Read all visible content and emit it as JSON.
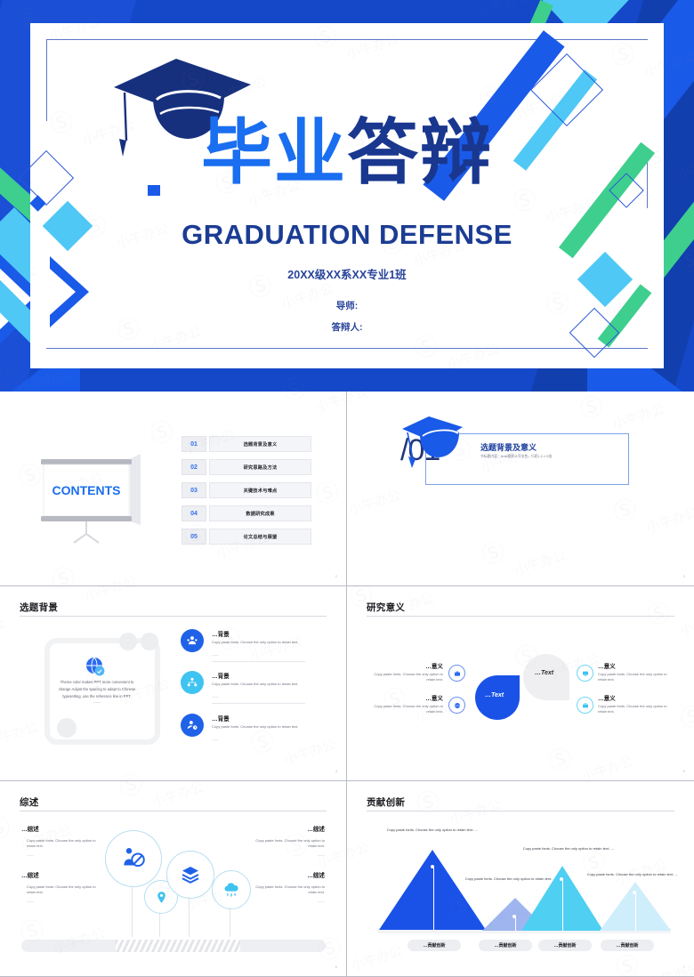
{
  "cover": {
    "title_light": "毕业",
    "title_dark": "答辩",
    "english_title": "GRADUATION DEFENSE",
    "class_line": "20XX级XX系XX专业1班",
    "advisor": "导师:",
    "presenter": "答辩人:",
    "icon_cap": "graduation-cap-icon"
  },
  "colors": {
    "brand_blue": "#1448c8",
    "bright_blue": "#1a6ef0",
    "navy": "#19378f",
    "sky": "#3fc3f0",
    "green": "#3ecf8e",
    "light_blue": "#4fb6f5"
  },
  "contents_slide": {
    "heading": "CONTENTS",
    "items": [
      {
        "num": "01",
        "label": "选题背景及意义"
      },
      {
        "num": "02",
        "label": "研究思路及方法"
      },
      {
        "num": "03",
        "label": "关键技术与难点"
      },
      {
        "num": "04",
        "label": "数据研究成果"
      },
      {
        "num": "05",
        "label": "论文总结与展望"
      }
    ],
    "page_number": "2"
  },
  "divider_slide": {
    "number": "/01",
    "heading": "选题背景及意义",
    "subtext": "节标题内容：Arial雅黑11号灰色，行距1.2-1.5倍",
    "page_number": "3"
  },
  "background_slide": {
    "title": "选题背景",
    "panel_text": "Theme color makes PPT more convenient to change.Adjust the spacing to adapt to Chinese typesetting, use the reference line in PPT.",
    "panel_tail": "——",
    "items": [
      {
        "heading": "…背景",
        "body": "Copy paste fonts. Choose the only option to retain text.",
        "icon": "users-group-icon",
        "color": "#1f62e8"
      },
      {
        "heading": "…背景",
        "body": "Copy paste fonts. Choose the only option to retain text.",
        "icon": "org-chart-icon",
        "color": "#3fc3f0"
      },
      {
        "heading": "…背景",
        "body": "Copy paste fonts. Choose the only option to retain text.",
        "icon": "user-clock-icon",
        "color": "#1f62e8"
      }
    ],
    "page_number": "4"
  },
  "significance_slide": {
    "title": "研究意义",
    "center_primary": "…Text",
    "center_secondary": "…Text",
    "items": [
      {
        "heading": "…意义",
        "body": "Copy paste fonts. Choose the only option to retain text.",
        "icon": "briefcase-icon",
        "side": "left"
      },
      {
        "heading": "…意义",
        "body": "Copy paste fonts. Choose the only option to retain text.",
        "icon": "globe-icon",
        "side": "left"
      },
      {
        "heading": "…意义",
        "body": "Copy paste fonts. Choose the only option to retain text.",
        "icon": "monitor-icon",
        "side": "right"
      },
      {
        "heading": "…意义",
        "body": "Copy paste fonts. Choose the only option to retain text.",
        "icon": "toolbox-icon",
        "side": "right"
      }
    ],
    "page_number": "5"
  },
  "review_slide": {
    "title": "综述",
    "items": [
      {
        "heading": "…综述",
        "body": "Copy paste fonts. Choose the only option to retain text.",
        "bullet_tail": "——"
      },
      {
        "heading": "…综述",
        "body": "Copy paste fonts. Choose the only option to retain text.",
        "bullet_tail": "——"
      },
      {
        "heading": "…综述",
        "body": "Copy paste fonts. Choose the only option to retain text.",
        "bullet_tail": "——"
      },
      {
        "heading": "…综述",
        "body": "Copy paste fonts. Choose the only option to retain text.",
        "bullet_tail": "——"
      }
    ],
    "icons": [
      "businessman-icon",
      "location-pin-icon",
      "layers-icon",
      "cloud-network-icon"
    ],
    "page_number": "6"
  },
  "contribution_slide": {
    "title": "贡献创新",
    "items": [
      {
        "body": "Copy paste fonts. Choose the only option to retain text.….",
        "label": "…贡献创新",
        "color": "#1a52e8"
      },
      {
        "body": "Copy paste fonts. Choose the only option to retain text.….",
        "label": "…贡献创新",
        "color": "#9fb5f0"
      },
      {
        "body": "Copy paste fonts. Choose the only option to retain text.….",
        "label": "…贡献创新",
        "color": "#4fcff2"
      },
      {
        "body": "Copy paste fonts. Choose the only option to retain text.….",
        "label": "…贡献创新",
        "color": "#cfeefb"
      }
    ],
    "page_number": "7"
  }
}
